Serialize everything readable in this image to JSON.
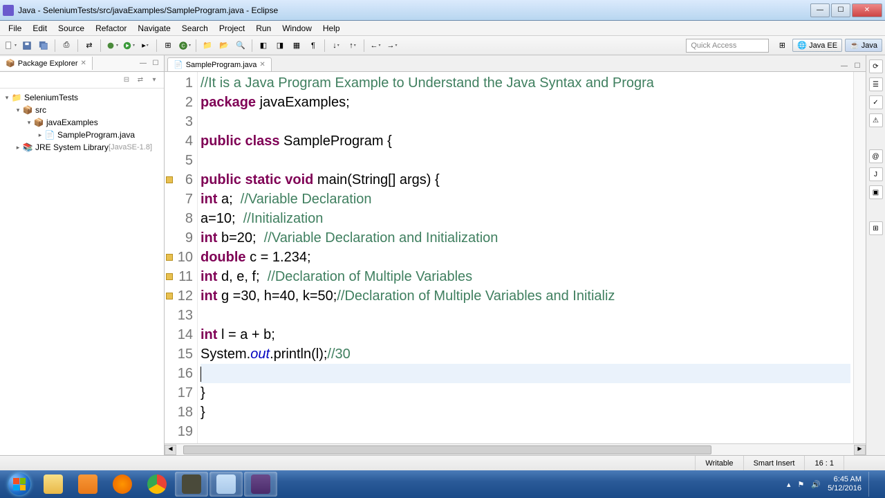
{
  "title": "Java - SeleniumTests/src/javaExamples/SampleProgram.java - Eclipse",
  "menu": [
    "File",
    "Edit",
    "Source",
    "Refactor",
    "Navigate",
    "Search",
    "Project",
    "Run",
    "Window",
    "Help"
  ],
  "quick_access": "Quick Access",
  "perspectives": {
    "java_ee": "Java EE",
    "java": "Java"
  },
  "package_explorer": {
    "title": "Package Explorer",
    "tree": {
      "project": "SeleniumTests",
      "src": "src",
      "pkg": "javaExamples",
      "file": "SampleProgram.java",
      "jre": "JRE System Library",
      "jre_ver": "[JavaSE-1.8]"
    }
  },
  "editor": {
    "tab": "SampleProgram.java",
    "lines": [
      {
        "n": 1,
        "seg": [
          {
            "t": "//It is a Java Program Example to Understand the Java Syntax and Progra",
            "c": "cm"
          }
        ]
      },
      {
        "n": 2,
        "seg": [
          {
            "t": "package",
            "c": "kw"
          },
          {
            "t": " javaExamples;"
          }
        ]
      },
      {
        "n": 3,
        "seg": []
      },
      {
        "n": 4,
        "seg": [
          {
            "t": "public class",
            "c": "kw"
          },
          {
            "t": " SampleProgram {"
          }
        ]
      },
      {
        "n": 5,
        "seg": []
      },
      {
        "n": 6,
        "warn": true,
        "seg": [
          {
            "t": "public static void",
            "c": "kw"
          },
          {
            "t": " main(String[] args) {"
          }
        ]
      },
      {
        "n": 7,
        "seg": [
          {
            "t": "int",
            "c": "kw"
          },
          {
            "t": " a;  "
          },
          {
            "t": "//Variable Declaration",
            "c": "cm"
          }
        ]
      },
      {
        "n": 8,
        "seg": [
          {
            "t": "a=10;  "
          },
          {
            "t": "//Initialization",
            "c": "cm"
          }
        ]
      },
      {
        "n": 9,
        "seg": [
          {
            "t": "int",
            "c": "kw"
          },
          {
            "t": " b=20;  "
          },
          {
            "t": "//Variable Declaration and Initialization",
            "c": "cm"
          }
        ]
      },
      {
        "n": 10,
        "warn": true,
        "seg": [
          {
            "t": "double",
            "c": "kw"
          },
          {
            "t": " c = 1.234;"
          }
        ]
      },
      {
        "n": 11,
        "warn": true,
        "seg": [
          {
            "t": "int",
            "c": "kw"
          },
          {
            "t": " d, e, f;  "
          },
          {
            "t": "//Declaration of Multiple Variables",
            "c": "cm"
          }
        ]
      },
      {
        "n": 12,
        "warn": true,
        "seg": [
          {
            "t": "int",
            "c": "kw"
          },
          {
            "t": " g =30, h=40, k=50;"
          },
          {
            "t": "//Declaration of Multiple Variables and Initializ",
            "c": "cm"
          }
        ]
      },
      {
        "n": 13,
        "seg": []
      },
      {
        "n": 14,
        "seg": [
          {
            "t": "int",
            "c": "kw"
          },
          {
            "t": " l = a + b;"
          }
        ]
      },
      {
        "n": 15,
        "seg": [
          {
            "t": "System."
          },
          {
            "t": "out",
            "c": "fld"
          },
          {
            "t": ".println(l);"
          },
          {
            "t": "//30",
            "c": "cm"
          }
        ]
      },
      {
        "n": 16,
        "current": true,
        "caret": true,
        "seg": []
      },
      {
        "n": 17,
        "seg": [
          {
            "t": "}"
          }
        ]
      },
      {
        "n": 18,
        "seg": [
          {
            "t": "}"
          }
        ]
      },
      {
        "n": 19,
        "seg": []
      }
    ]
  },
  "status": {
    "writable": "Writable",
    "insert": "Smart Insert",
    "pos": "16 : 1"
  },
  "tray": {
    "time": "6:45 AM",
    "date": "5/12/2016"
  }
}
